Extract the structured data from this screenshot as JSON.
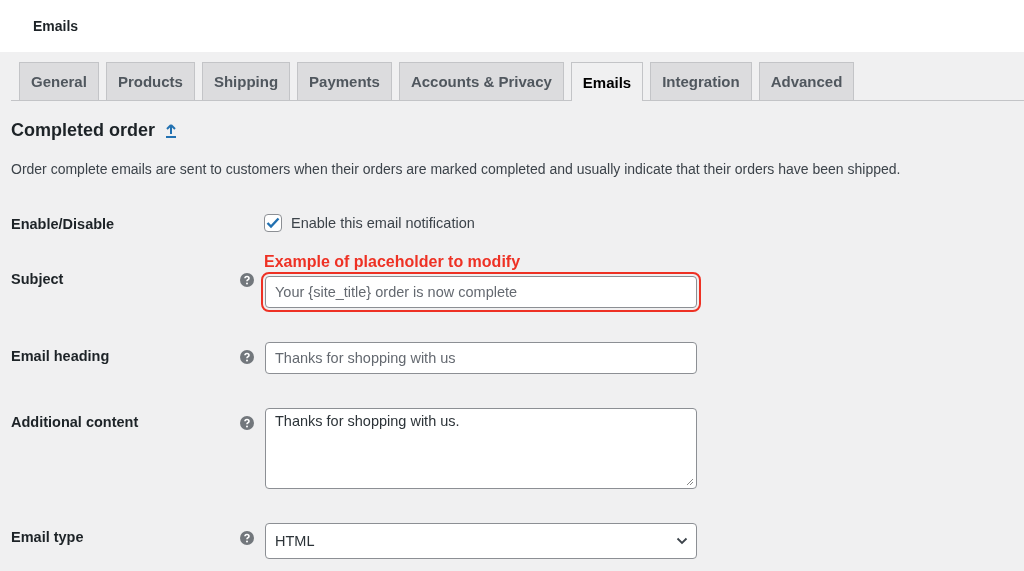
{
  "page_title": "Emails",
  "tabs": [
    {
      "label": "General",
      "selected": false
    },
    {
      "label": "Products",
      "selected": false
    },
    {
      "label": "Shipping",
      "selected": false
    },
    {
      "label": "Payments",
      "selected": false
    },
    {
      "label": "Accounts & Privacy",
      "selected": false
    },
    {
      "label": "Emails",
      "selected": true
    },
    {
      "label": "Integration",
      "selected": false
    },
    {
      "label": "Advanced",
      "selected": false
    }
  ],
  "section": {
    "title": "Completed order",
    "description": "Order complete emails are sent to customers when their orders are marked completed and usually indicate that their orders have been shipped."
  },
  "fields": [
    {
      "kind": "checkbox",
      "label": "Enable/Disable",
      "text": "Enable this email notification",
      "checked": true
    },
    {
      "kind": "text",
      "label": "Subject",
      "placeholder": "Your {site_title} order is now complete",
      "annotation": "Example of placeholder to modify",
      "highlighted": true
    },
    {
      "kind": "text",
      "label": "Email heading",
      "placeholder": "Thanks for shopping with us",
      "highlighted": false
    },
    {
      "kind": "textarea",
      "label": "Additional content",
      "value": "Thanks for shopping with us.",
      "highlighted": false
    },
    {
      "kind": "select",
      "label": "Email type",
      "value": "HTML",
      "highlighted": false
    }
  ]
}
